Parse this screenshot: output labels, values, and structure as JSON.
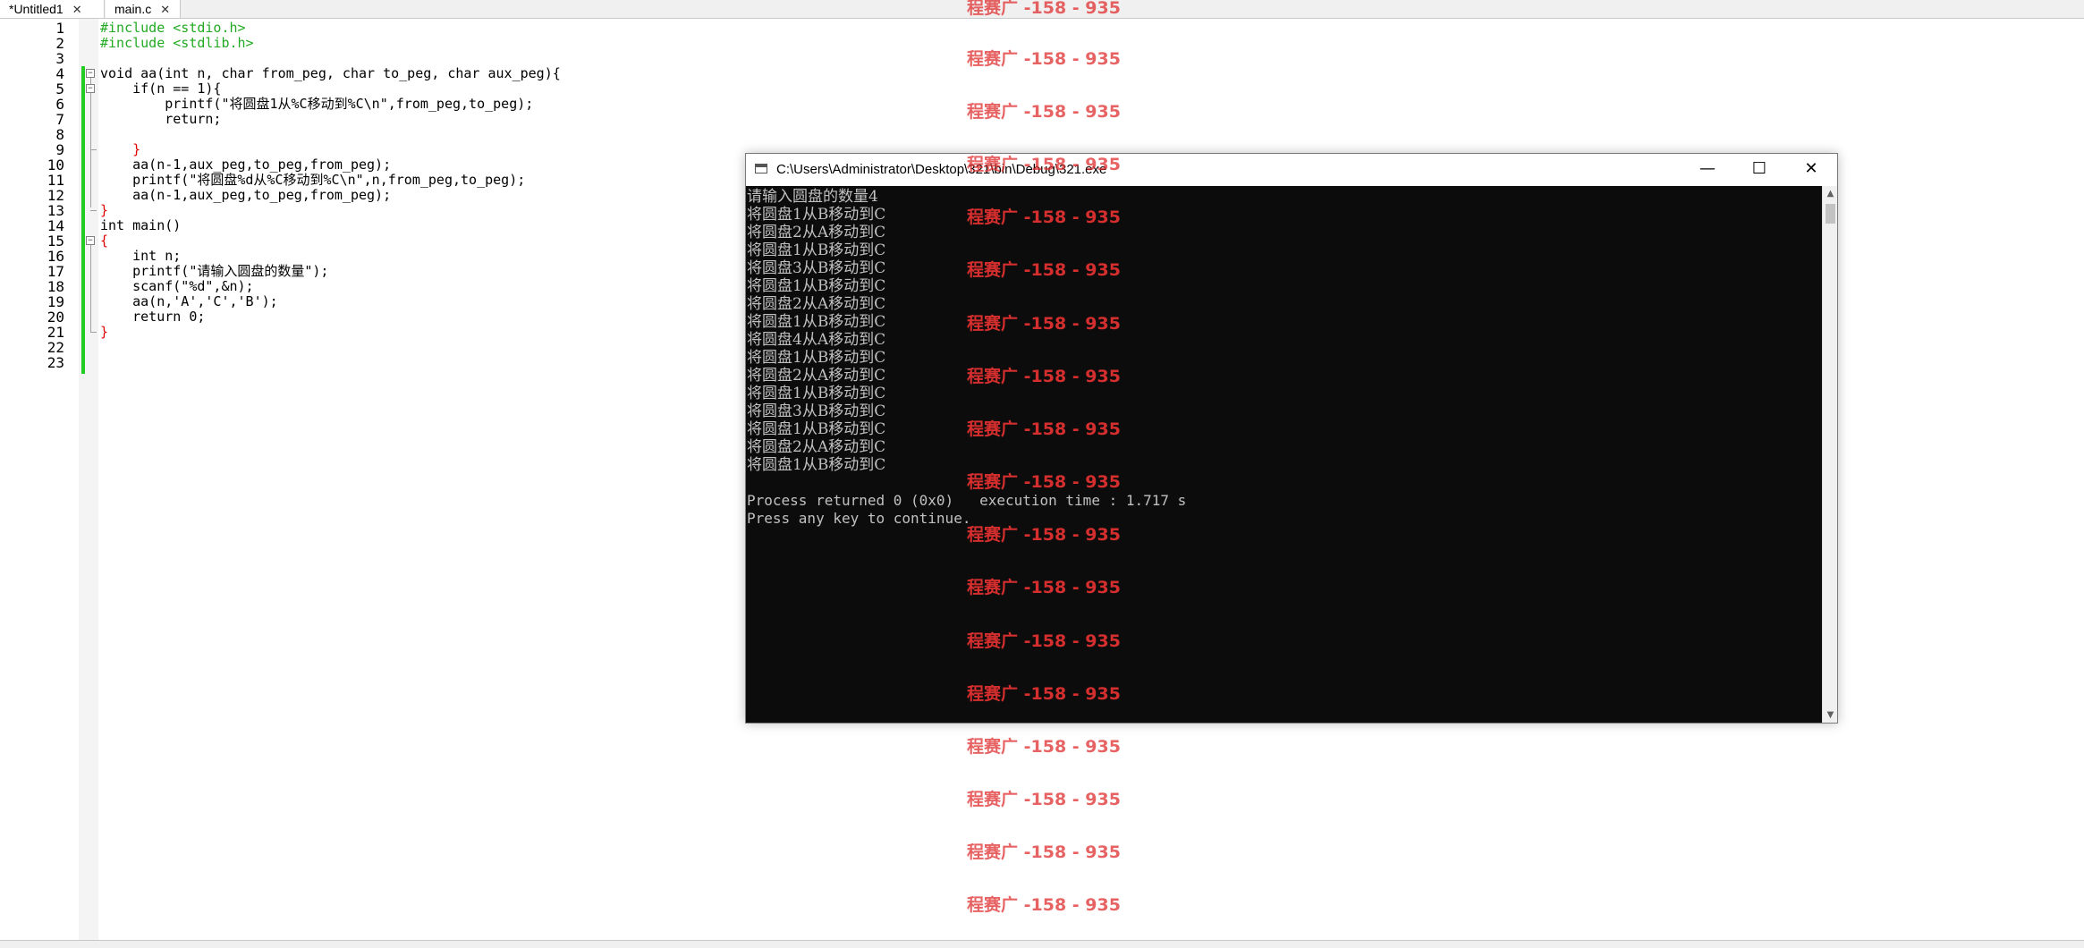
{
  "tabs": [
    {
      "label": "*Untitled1",
      "close": "✕"
    },
    {
      "label": "main.c",
      "close": "✕"
    }
  ],
  "editor": {
    "line_numbers": [
      "1",
      "2",
      "3",
      "4",
      "5",
      "6",
      "7",
      "8",
      "9",
      "10",
      "11",
      "12",
      "13",
      "14",
      "15",
      "16",
      "17",
      "18",
      "19",
      "20",
      "21",
      "22",
      "23"
    ],
    "code": [
      "#include <stdio.h>",
      "#include <stdlib.h>",
      "",
      "void aa(int n, char from_peg, char to_peg, char aux_peg){",
      "    if(n == 1){",
      "        printf(\"将圆盘1从%C移动到%C\\n\",from_peg,to_peg);",
      "        return;",
      "",
      "    }",
      "    aa(n-1,aux_peg,to_peg,from_peg);",
      "    printf(\"将圆盘%d从%C移动到%C\\n\",n,from_peg,to_peg);",
      "    aa(n-1,aux_peg,to_peg,from_peg);",
      "}",
      "int main()",
      "{",
      "    int n;",
      "    printf(\"请输入圆盘的数量\");",
      "    scanf(\"%d\",&n);",
      "    aa(n,'A','C','B');",
      "    return 0;",
      "}",
      "",
      ""
    ]
  },
  "console": {
    "title": "C:\\Users\\Administrator\\Desktop\\321\\bin\\Debug\\321.exe",
    "minimize_glyph": "—",
    "maximize_glyph": "☐",
    "close_glyph": "✕",
    "lines": [
      "请输入圆盘的数量4",
      "将圆盘1从B移动到C",
      "将圆盘2从A移动到C",
      "将圆盘1从B移动到C",
      "将圆盘3从B移动到C",
      "将圆盘1从B移动到C",
      "将圆盘2从A移动到C",
      "将圆盘1从B移动到C",
      "将圆盘4从A移动到C",
      "将圆盘1从B移动到C",
      "将圆盘2从A移动到C",
      "将圆盘1从B移动到C",
      "将圆盘3从B移动到C",
      "将圆盘1从B移动到C",
      "将圆盘2从A移动到C",
      "将圆盘1从B移动到C",
      "",
      "Process returned 0 (0x0)   execution time : 1.717 s",
      "Press any key to continue."
    ],
    "scroll_up_glyph": "▲",
    "scroll_down_glyph": "▼"
  },
  "watermark": {
    "text": "程赛广 -158 - 935",
    "color": "#e03030"
  }
}
